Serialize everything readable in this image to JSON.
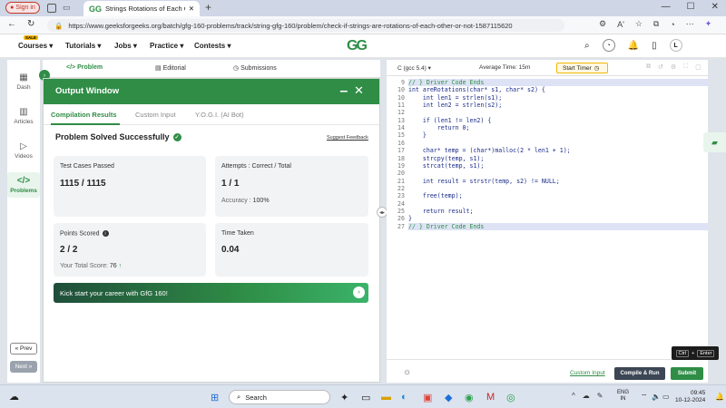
{
  "browser": {
    "signin_label": "Sign in",
    "tab_title": "Strings Rotations of Each Other | ...",
    "url": "https://www.geeksforgeeks.org/batch/gfg-160-problems/track/string-gfg-160/problem/check-if-strings-are-rotations-of-each-other-or-not-1587115620",
    "reader_label": "Aʹ"
  },
  "site_nav": {
    "sale_badge": "SALE",
    "items": [
      "Courses ▾",
      "Tutorials ▾",
      "Jobs ▾",
      "Practice ▾",
      "Contests ▾"
    ],
    "logo": "GG",
    "avatar_letter": "L"
  },
  "sidebar": {
    "items": [
      "Dash",
      "Articles",
      "Videos",
      "Problems"
    ],
    "prev": "« Prev",
    "next": "Next »"
  },
  "problem_tabs": [
    "</> Problem",
    "Editorial",
    "Submissions"
  ],
  "output_window": {
    "title": "Output Window",
    "tabs": [
      "Compilation Results",
      "Custom Input",
      "Y.O.G.I. (AI Bot)"
    ],
    "status": "Problem Solved Successfully",
    "feedback": "Suggest Feedback",
    "test_cases_label": "Test Cases Passed",
    "test_cases_value": "1115 / 1115",
    "attempts_label": "Attempts : Correct / Total",
    "attempts_value": "1 / 1",
    "accuracy_label": "Accuracy :",
    "accuracy_value": "100%",
    "points_label": "Points Scored",
    "points_value": "2 / 2",
    "total_score_label": "Your Total Score:",
    "total_score_value": "76",
    "time_label": "Time Taken",
    "time_value": "0.04",
    "banner": "Kick start your career with GfG 160!"
  },
  "editor": {
    "language": "C (gcc 5.4)",
    "avg_time": "Average Time: 15m",
    "timer_label": "Start Timer",
    "lines": [
      {
        "n": "9",
        "text": "// } Driver Code Ends"
      },
      {
        "n": "10",
        "text": "int areRotations(char* s1, char* s2) {"
      },
      {
        "n": "10",
        "text": "    int len1 = strlen(s1);"
      },
      {
        "n": "11",
        "text": "    int len2 = strlen(s2);"
      },
      {
        "n": "12",
        "text": ""
      },
      {
        "n": "13",
        "text": "    if (len1 != len2) {"
      },
      {
        "n": "14",
        "text": "        return 0;"
      },
      {
        "n": "15",
        "text": "    }"
      },
      {
        "n": "16",
        "text": ""
      },
      {
        "n": "17",
        "text": "    char* temp = (char*)malloc(2 * len1 + 1);"
      },
      {
        "n": "18",
        "text": "    strcpy(temp, s1);"
      },
      {
        "n": "19",
        "text": "    strcat(temp, s1);"
      },
      {
        "n": "20",
        "text": ""
      },
      {
        "n": "21",
        "text": "    int result = strstr(temp, s2) != NULL;"
      },
      {
        "n": "22",
        "text": ""
      },
      {
        "n": "23",
        "text": "    free(temp);"
      },
      {
        "n": "24",
        "text": ""
      },
      {
        "n": "25",
        "text": "    return result;"
      },
      {
        "n": "26",
        "text": "}"
      },
      {
        "n": "27",
        "text": "// } Driver Code Ends"
      }
    ],
    "custom_input": "Custom Input",
    "compile_run": "Compile & Run",
    "submit": "Submit",
    "kb_ctrl": "Ctrl",
    "kb_plus": "+",
    "kb_enter": "Enter"
  },
  "taskbar": {
    "search_placeholder": "Search",
    "lang_top": "ENG",
    "lang_bottom": "IN",
    "time": "09:45",
    "date": "10-12-2024"
  },
  "colors": {
    "brand": "#2f8d46",
    "header": "#2f8d46",
    "compile_button": "#3c4654"
  }
}
